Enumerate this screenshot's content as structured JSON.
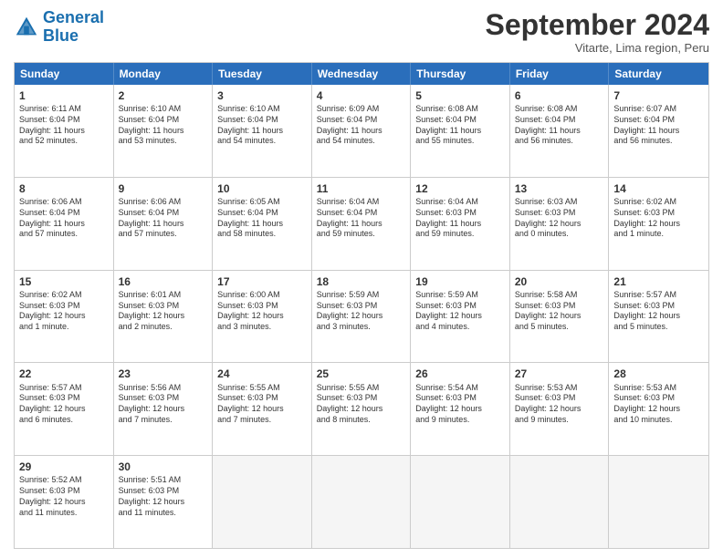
{
  "header": {
    "logo_general": "General",
    "logo_blue": "Blue",
    "month_title": "September 2024",
    "location": "Vitarte, Lima region, Peru"
  },
  "weekdays": [
    "Sunday",
    "Monday",
    "Tuesday",
    "Wednesday",
    "Thursday",
    "Friday",
    "Saturday"
  ],
  "rows": [
    [
      {
        "day": "1",
        "text": "Sunrise: 6:11 AM\nSunset: 6:04 PM\nDaylight: 11 hours\nand 52 minutes."
      },
      {
        "day": "2",
        "text": "Sunrise: 6:10 AM\nSunset: 6:04 PM\nDaylight: 11 hours\nand 53 minutes."
      },
      {
        "day": "3",
        "text": "Sunrise: 6:10 AM\nSunset: 6:04 PM\nDaylight: 11 hours\nand 54 minutes."
      },
      {
        "day": "4",
        "text": "Sunrise: 6:09 AM\nSunset: 6:04 PM\nDaylight: 11 hours\nand 54 minutes."
      },
      {
        "day": "5",
        "text": "Sunrise: 6:08 AM\nSunset: 6:04 PM\nDaylight: 11 hours\nand 55 minutes."
      },
      {
        "day": "6",
        "text": "Sunrise: 6:08 AM\nSunset: 6:04 PM\nDaylight: 11 hours\nand 56 minutes."
      },
      {
        "day": "7",
        "text": "Sunrise: 6:07 AM\nSunset: 6:04 PM\nDaylight: 11 hours\nand 56 minutes."
      }
    ],
    [
      {
        "day": "8",
        "text": "Sunrise: 6:06 AM\nSunset: 6:04 PM\nDaylight: 11 hours\nand 57 minutes."
      },
      {
        "day": "9",
        "text": "Sunrise: 6:06 AM\nSunset: 6:04 PM\nDaylight: 11 hours\nand 57 minutes."
      },
      {
        "day": "10",
        "text": "Sunrise: 6:05 AM\nSunset: 6:04 PM\nDaylight: 11 hours\nand 58 minutes."
      },
      {
        "day": "11",
        "text": "Sunrise: 6:04 AM\nSunset: 6:04 PM\nDaylight: 11 hours\nand 59 minutes."
      },
      {
        "day": "12",
        "text": "Sunrise: 6:04 AM\nSunset: 6:03 PM\nDaylight: 11 hours\nand 59 minutes."
      },
      {
        "day": "13",
        "text": "Sunrise: 6:03 AM\nSunset: 6:03 PM\nDaylight: 12 hours\nand 0 minutes."
      },
      {
        "day": "14",
        "text": "Sunrise: 6:02 AM\nSunset: 6:03 PM\nDaylight: 12 hours\nand 1 minute."
      }
    ],
    [
      {
        "day": "15",
        "text": "Sunrise: 6:02 AM\nSunset: 6:03 PM\nDaylight: 12 hours\nand 1 minute."
      },
      {
        "day": "16",
        "text": "Sunrise: 6:01 AM\nSunset: 6:03 PM\nDaylight: 12 hours\nand 2 minutes."
      },
      {
        "day": "17",
        "text": "Sunrise: 6:00 AM\nSunset: 6:03 PM\nDaylight: 12 hours\nand 3 minutes."
      },
      {
        "day": "18",
        "text": "Sunrise: 5:59 AM\nSunset: 6:03 PM\nDaylight: 12 hours\nand 3 minutes."
      },
      {
        "day": "19",
        "text": "Sunrise: 5:59 AM\nSunset: 6:03 PM\nDaylight: 12 hours\nand 4 minutes."
      },
      {
        "day": "20",
        "text": "Sunrise: 5:58 AM\nSunset: 6:03 PM\nDaylight: 12 hours\nand 5 minutes."
      },
      {
        "day": "21",
        "text": "Sunrise: 5:57 AM\nSunset: 6:03 PM\nDaylight: 12 hours\nand 5 minutes."
      }
    ],
    [
      {
        "day": "22",
        "text": "Sunrise: 5:57 AM\nSunset: 6:03 PM\nDaylight: 12 hours\nand 6 minutes."
      },
      {
        "day": "23",
        "text": "Sunrise: 5:56 AM\nSunset: 6:03 PM\nDaylight: 12 hours\nand 7 minutes."
      },
      {
        "day": "24",
        "text": "Sunrise: 5:55 AM\nSunset: 6:03 PM\nDaylight: 12 hours\nand 7 minutes."
      },
      {
        "day": "25",
        "text": "Sunrise: 5:55 AM\nSunset: 6:03 PM\nDaylight: 12 hours\nand 8 minutes."
      },
      {
        "day": "26",
        "text": "Sunrise: 5:54 AM\nSunset: 6:03 PM\nDaylight: 12 hours\nand 9 minutes."
      },
      {
        "day": "27",
        "text": "Sunrise: 5:53 AM\nSunset: 6:03 PM\nDaylight: 12 hours\nand 9 minutes."
      },
      {
        "day": "28",
        "text": "Sunrise: 5:53 AM\nSunset: 6:03 PM\nDaylight: 12 hours\nand 10 minutes."
      }
    ],
    [
      {
        "day": "29",
        "text": "Sunrise: 5:52 AM\nSunset: 6:03 PM\nDaylight: 12 hours\nand 11 minutes."
      },
      {
        "day": "30",
        "text": "Sunrise: 5:51 AM\nSunset: 6:03 PM\nDaylight: 12 hours\nand 11 minutes."
      },
      {
        "day": "",
        "text": "",
        "empty": true
      },
      {
        "day": "",
        "text": "",
        "empty": true
      },
      {
        "day": "",
        "text": "",
        "empty": true
      },
      {
        "day": "",
        "text": "",
        "empty": true
      },
      {
        "day": "",
        "text": "",
        "empty": true
      }
    ]
  ]
}
